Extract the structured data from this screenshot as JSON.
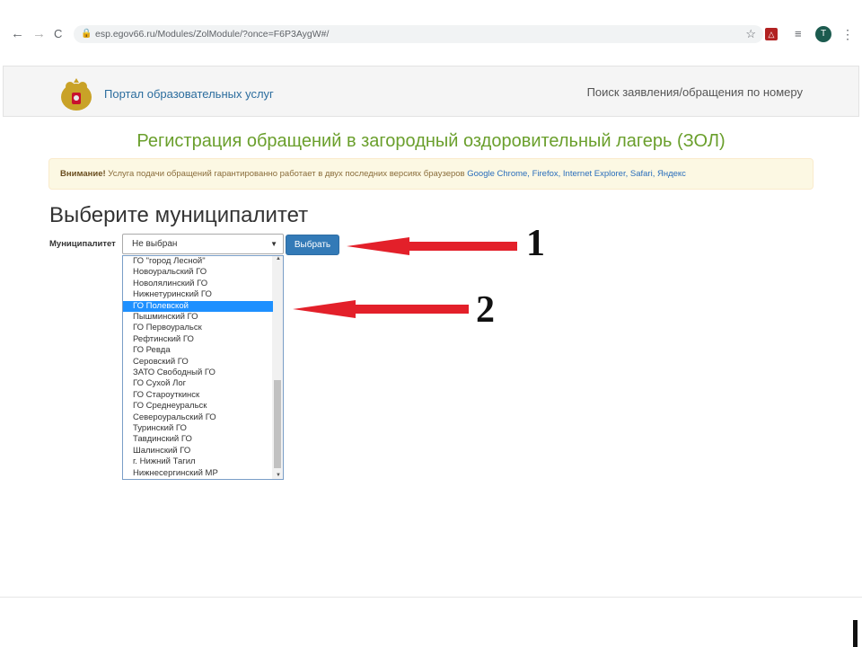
{
  "browser": {
    "back_icon": "←",
    "forward_icon": "→",
    "reload_icon": "C",
    "url": "esp.egov66.ru/Modules/ZolModule/?once=F6P3AygW#/",
    "avatar_letter": "T"
  },
  "header": {
    "portal_link": "Портал образовательных услуг",
    "search_link": "Поиск заявления/обращения по номеру"
  },
  "main": {
    "title": "Регистрация обращений в загородный оздоровительный лагерь (ЗОЛ)",
    "alert": {
      "strong": "Внимание!",
      "text": " Услуга подачи обращений гарантированно работает в двух последних версиях браузеров ",
      "browsers": "Google Chrome, Firefox, Internet Explorer, Safari, Яндекс"
    },
    "section_title": "Выберите муниципалитет",
    "field_label": "Муниципалитет",
    "select_value": "Не выбран",
    "choose_button": "Выбрать",
    "options": [
      "ГО \"город Лесной\"",
      "Новоуральский ГО",
      "Новолялинский ГО",
      "Нижнетуринский ГО",
      "ГО Полевской",
      "Пышминский ГО",
      "ГО Первоуральск",
      "Рефтинский ГО",
      "ГО Ревда",
      "Серовский ГО",
      "ЗАТО Свободный ГО",
      "ГО Сухой Лог",
      "ГО Староуткинск",
      "ГО Среднеуральск",
      "Североуральский ГО",
      "Туринский ГО",
      "Тавдинский ГО",
      "Шалинский ГО",
      "г. Нижний Тагил",
      "Нижнесергинский МР"
    ],
    "selected_option_index": 4
  },
  "annotations": {
    "marker_1": "1",
    "marker_2": "2",
    "arrow_color": "#e3202a"
  }
}
